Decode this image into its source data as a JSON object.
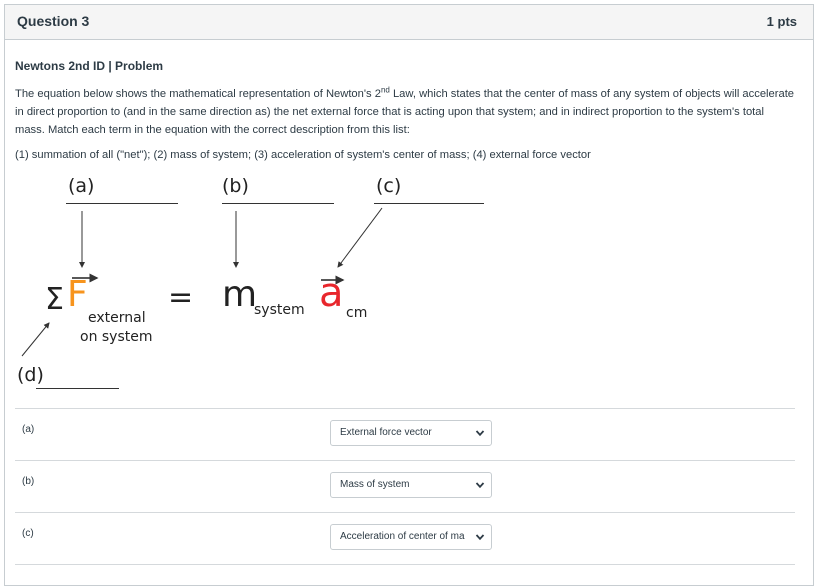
{
  "question": {
    "title": "Question 3",
    "points": "1 pts"
  },
  "problem": {
    "title": "Newtons 2nd ID  |  Problem",
    "text_before_sup": "The equation below shows the mathematical representation of Newton's 2",
    "sup": "nd",
    "text_after_sup": " Law, which states that the center of mass of any system of objects will accelerate in direct proportion to (and in the same direction as) the net external force that is acting upon that system; and in indirect proportion to the system's total mass.  Match each term in the equation with the correct description from this list:",
    "terms": "(1) summation of all (\"net\");  (2) mass of system;  (3) acceleration of system's center of mass;  (4) external force vector"
  },
  "diagram": {
    "label_a": "(a)",
    "label_b": "(b)",
    "label_c": "(c)",
    "label_d": "(d)",
    "sigma": "Σ",
    "force": "F",
    "force_sub_line1": "external",
    "force_sub_line2": "on system",
    "equals": "=",
    "mass": "m",
    "mass_sub": "system",
    "accel": "a",
    "accel_sub": "cm"
  },
  "answers": [
    {
      "label": "(a)",
      "selected": "External force vector"
    },
    {
      "label": "(b)",
      "selected": "Mass of system"
    },
    {
      "label": "(c)",
      "selected": "Acceleration of center of ma"
    }
  ]
}
